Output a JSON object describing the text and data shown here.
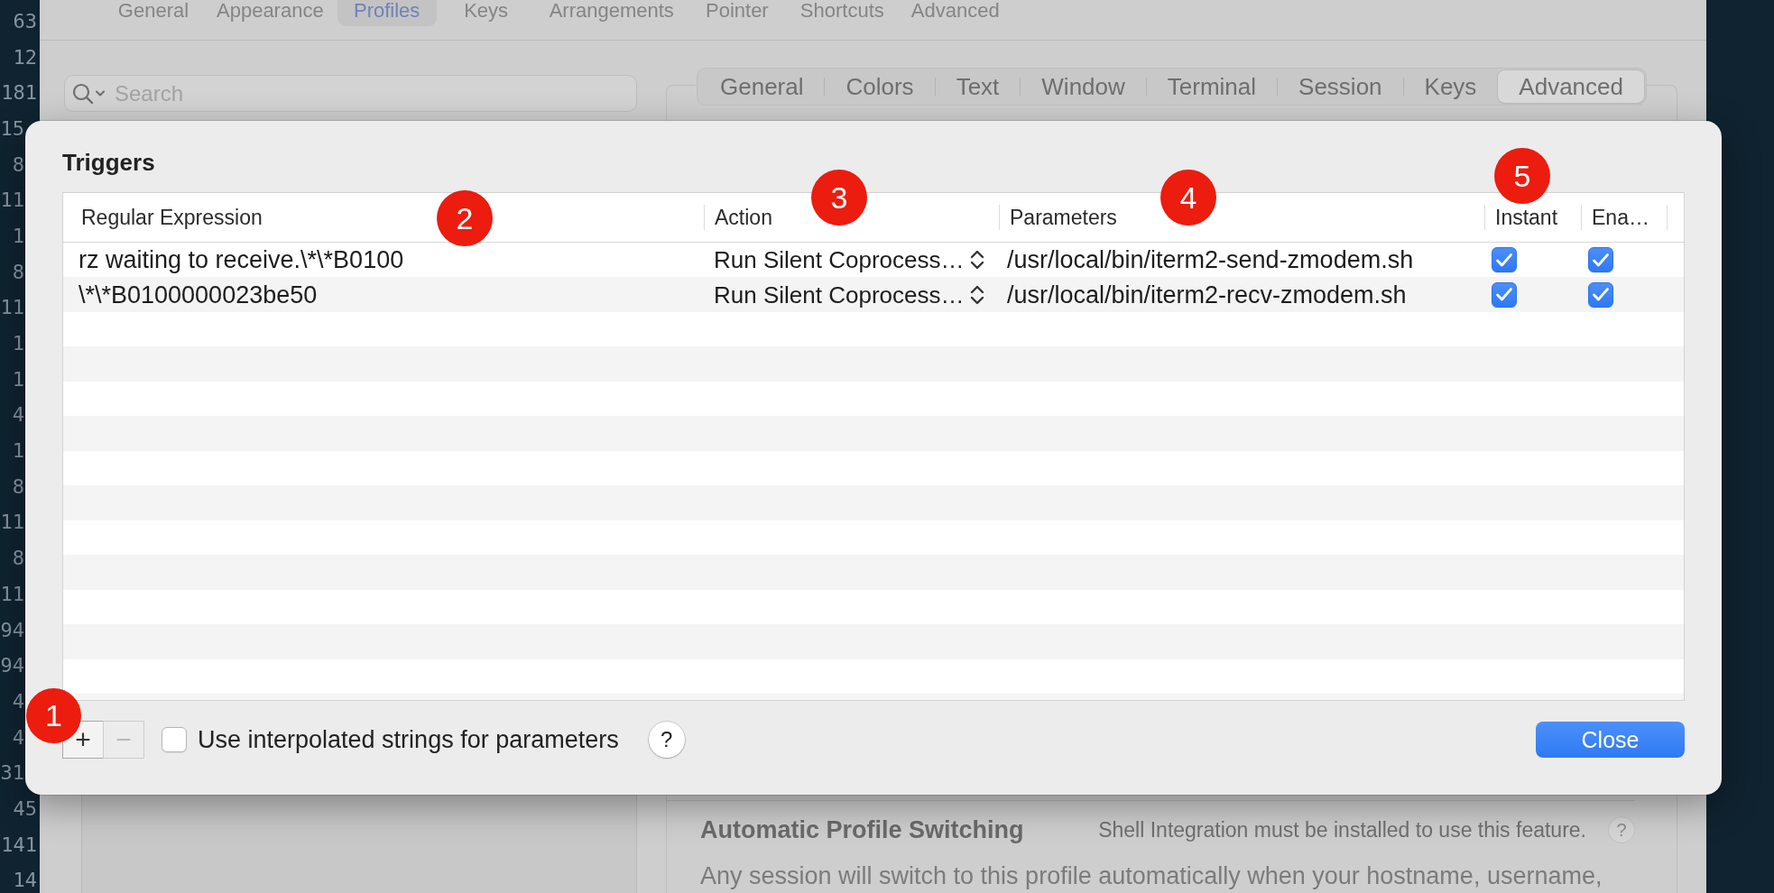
{
  "terminal": {
    "lines": [
      "63",
      "12",
      "181",
      "15",
      "8",
      "11",
      "1",
      "8",
      "11",
      "1",
      "1",
      "4",
      "1",
      "8",
      "11",
      "8",
      "11",
      "94",
      "94",
      "4",
      "4",
      "31",
      "45",
      "141",
      "14"
    ]
  },
  "preferences": {
    "toolbar": [
      {
        "label": "General",
        "selected": false
      },
      {
        "label": "Appearance",
        "selected": false
      },
      {
        "label": "Profiles",
        "selected": true
      },
      {
        "label": "Keys",
        "selected": false
      },
      {
        "label": "Arrangements",
        "selected": false
      },
      {
        "label": "Pointer",
        "selected": false
      },
      {
        "label": "Shortcuts",
        "selected": false
      },
      {
        "label": "Advanced",
        "selected": false
      }
    ],
    "search": {
      "placeholder": "Search"
    },
    "profile_tabs": [
      {
        "label": "General",
        "selected": false
      },
      {
        "label": "Colors",
        "selected": false
      },
      {
        "label": "Text",
        "selected": false
      },
      {
        "label": "Window",
        "selected": false
      },
      {
        "label": "Terminal",
        "selected": false
      },
      {
        "label": "Session",
        "selected": false
      },
      {
        "label": "Keys",
        "selected": false
      },
      {
        "label": "Advanced",
        "selected": true
      }
    ],
    "automatic_profile_switching": {
      "title": "Automatic Profile Switching",
      "note": "Shell Integration must be installed to use this feature.",
      "help": "?",
      "description": "Any session will switch to this profile automatically when your hostname, username,"
    }
  },
  "triggers": {
    "title": "Triggers",
    "columns": [
      {
        "label": "Regular Expression",
        "marker": "2"
      },
      {
        "label": "Action",
        "marker": "3"
      },
      {
        "label": "Parameters",
        "marker": "4"
      },
      {
        "label": "Instant",
        "marker": "5"
      },
      {
        "label": "Ena…"
      }
    ],
    "rows": [
      {
        "regular_expression": "rz waiting to receive.\\*\\*B0100",
        "action": "Run Silent Coprocess…",
        "parameters": "/usr/local/bin/iterm2-send-zmodem.sh",
        "instant": true,
        "enabled": true
      },
      {
        "regular_expression": "\\*\\*B0100000023be50",
        "action": "Run Silent Coprocess…",
        "parameters": "/usr/local/bin/iterm2-recv-zmodem.sh",
        "instant": true,
        "enabled": true
      }
    ],
    "row_buttons": [
      {
        "label": "+",
        "disabled": false,
        "marker": "1"
      },
      {
        "label": "−",
        "disabled": true
      }
    ],
    "interpolated_strings": {
      "label": "Use interpolated strings for parameters",
      "checked": false
    },
    "help": "?",
    "close_button": "Close"
  }
}
